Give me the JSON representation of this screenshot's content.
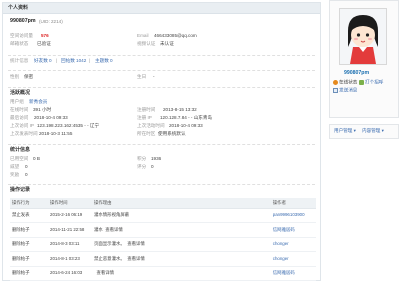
{
  "panel": {
    "title": "个人资料"
  },
  "profile": {
    "username": "990807pm",
    "uid": "(UID: 2214)",
    "email_check_label": "邮箱状态",
    "email_check_value": "已验证",
    "space_label": "空间访问量",
    "space_value": "576",
    "email_label": "Email",
    "email_value": "466433085@qq.com",
    "video_label": "视频认证",
    "video_value": "未认证"
  },
  "stats": {
    "label": "统计信息",
    "friends": "好友数 0",
    "replies": "回帖数 1042",
    "threads": "主题数 0",
    "sep1": "|",
    "sep2": "|"
  },
  "personal": {
    "gender_label": "性别",
    "gender_value": "保密",
    "birthday_label": "生日",
    "birthday_value": "-"
  },
  "activity": {
    "title": "活跃概况",
    "group_label": "用户组",
    "group_value": "新秀会员",
    "online_label": "在线时间",
    "online_value": "391 小时",
    "reg_label": "注册时间",
    "reg_value": "2013-8-15 13:32",
    "regip_label": "注册 IP",
    "regip_value": "120.128.7.84 - - 山东青岛",
    "lastvisit_label": "最后访问",
    "lastvisit_value": "2018-10-4 09:33",
    "lastip_label": "上次访问 IP",
    "lastip_value": "123.198.223.162:4535 - - 辽宁",
    "lastact_label": "上次活动时间",
    "lastact_value": "2018-10-4 09:33",
    "lastpost_label": "上次发表时间",
    "lastpost_value": "2018-10-3 11:55",
    "tz_label": "所在时区",
    "tz_value": "使用系统默认"
  },
  "counts": {
    "title": "统计信息",
    "used_label": "已用空间",
    "used_value": "0 B",
    "points_label": "积分",
    "points_value": "1936",
    "prestige_label": "威望",
    "prestige_value": "0",
    "score_label": "评分",
    "score_value": "0",
    "reward_label": "奖励",
    "reward_value": "0"
  },
  "ops": {
    "title": "操作记录",
    "headers": [
      "操作行为",
      "操作时间",
      "操作理由",
      "",
      "操作者"
    ],
    "rows": [
      {
        "action": "禁止发表",
        "time": "2015-2-16 06:19",
        "reason": "灌水情形视角屏蔽",
        "extra": "",
        "op": "pan9996103900"
      },
      {
        "action": "删除帖子",
        "time": "2014-11-21 22:58",
        "reason": "灌水",
        "extra": "查看详情",
        "op": "信网雅居码"
      },
      {
        "action": "删除帖子",
        "time": "2014-8-3 03:11",
        "reason": "页面显示灌水。",
        "extra": "查看详情",
        "op": "chonger"
      },
      {
        "action": "删除帖子",
        "time": "2014-8-1 03:23",
        "reason": "禁止恶意灌水。",
        "extra": "查看详情",
        "op": "chonger"
      },
      {
        "action": "删除帖子",
        "time": "2014-6-24 16:03",
        "reason": "",
        "extra": "查看详情",
        "op": "信网雅居码"
      }
    ]
  },
  "sidebar": {
    "name": "990807pm",
    "online": "在线状态",
    "follow": "打个招呼",
    "message": "发送消息",
    "menu_user": "用户管理",
    "menu_content": "内容管理",
    "arrow": "▾",
    "colors": {
      "accent": "#3b6cb0",
      "name": "#1a6fb0"
    }
  }
}
